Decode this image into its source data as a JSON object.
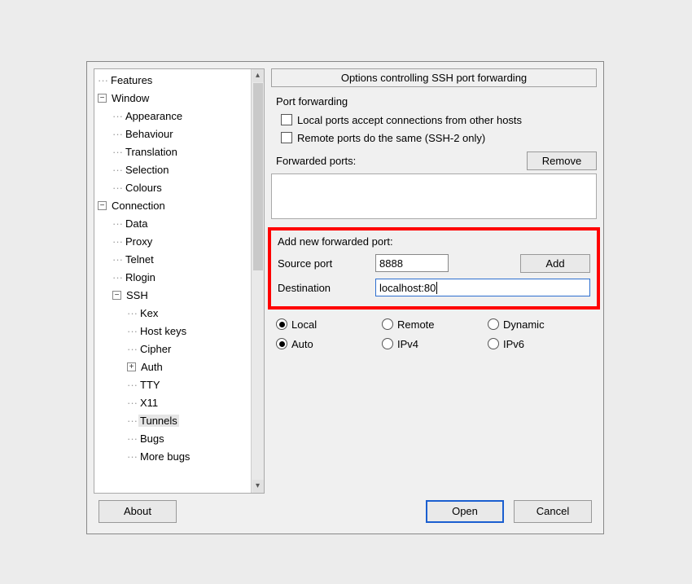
{
  "panel": {
    "title": "Options controlling SSH port forwarding"
  },
  "tree": {
    "nodes": {
      "features": "Features",
      "window": "Window",
      "appearance": "Appearance",
      "behaviour": "Behaviour",
      "translation": "Translation",
      "selection": "Selection",
      "colours": "Colours",
      "connection": "Connection",
      "data": "Data",
      "proxy": "Proxy",
      "telnet": "Telnet",
      "rlogin": "Rlogin",
      "ssh": "SSH",
      "kex": "Kex",
      "hostkeys": "Host keys",
      "cipher": "Cipher",
      "auth": "Auth",
      "tty": "TTY",
      "x11": "X11",
      "tunnels": "Tunnels",
      "bugs": "Bugs",
      "morebugs": "More bugs"
    }
  },
  "portfwd": {
    "group_label": "Port forwarding",
    "chk_local": "Local ports accept connections from other hosts",
    "chk_remote": "Remote ports do the same (SSH-2 only)",
    "forwarded_label": "Forwarded ports:",
    "remove_label": "Remove",
    "addnew_label": "Add new forwarded port:",
    "source_label": "Source port",
    "source_value": "8888",
    "dest_label": "Destination",
    "dest_value": "localhost:80",
    "add_label": "Add",
    "radios1": {
      "local": "Local",
      "remote": "Remote",
      "dynamic": "Dynamic"
    },
    "radios2": {
      "auto": "Auto",
      "ipv4": "IPv4",
      "ipv6": "IPv6"
    }
  },
  "buttons": {
    "about": "About",
    "open": "Open",
    "cancel": "Cancel"
  }
}
